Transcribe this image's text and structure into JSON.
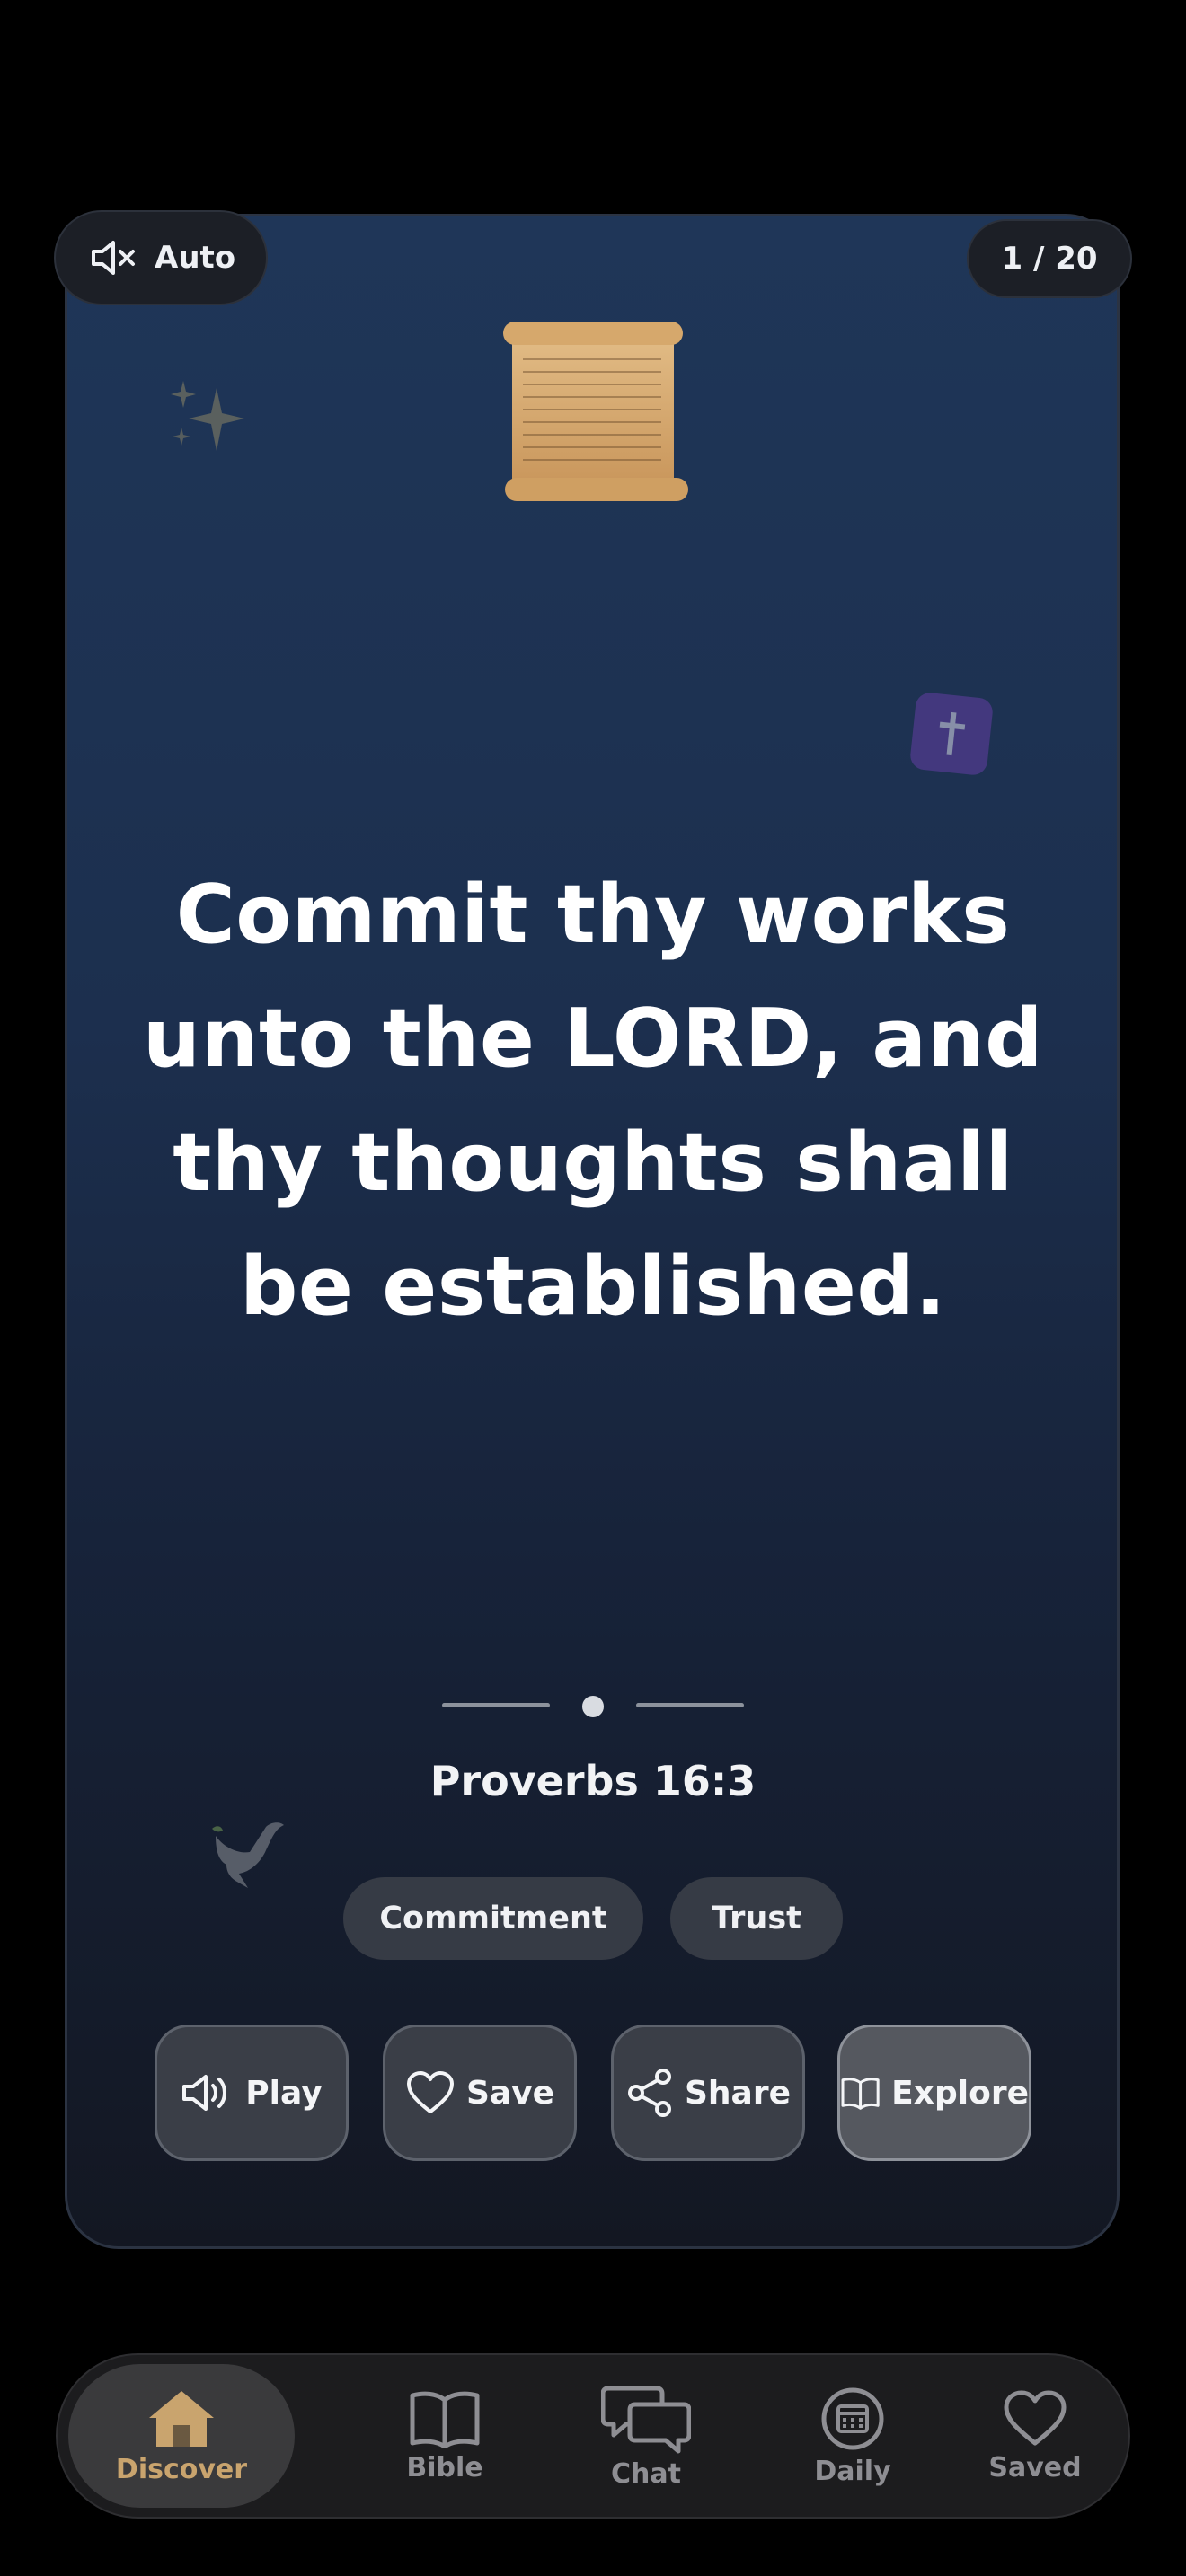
{
  "top_controls": {
    "sound_label": "Auto",
    "sound_icon": "speaker-muted-icon",
    "counter": "1 / 20"
  },
  "verse": {
    "text": "Commit thy works unto the LORD, and thy thoughts shall be established.",
    "reference": "Proverbs 16:3",
    "tags": [
      "Commitment",
      "Trust"
    ]
  },
  "actions": [
    {
      "label": "Play",
      "icon": "speaker-icon"
    },
    {
      "label": "Save",
      "icon": "heart-icon"
    },
    {
      "label": "Share",
      "icon": "share-icon"
    },
    {
      "label": "Explore",
      "icon": "open-book-icon"
    }
  ],
  "nav": {
    "items": [
      {
        "label": "Discover",
        "icon": "home-icon",
        "active": true
      },
      {
        "label": "Bible",
        "icon": "book-icon"
      },
      {
        "label": "Chat",
        "icon": "chat-bubbles-icon"
      },
      {
        "label": "Daily",
        "icon": "calendar-icon"
      },
      {
        "label": "Saved",
        "icon": "heart-icon"
      }
    ]
  },
  "colors": {
    "background": "#000000",
    "card_top": "#1f3658",
    "card_bottom": "#131722",
    "accent_active": "#c9a46e",
    "nav_inactive": "#8e8e93"
  }
}
